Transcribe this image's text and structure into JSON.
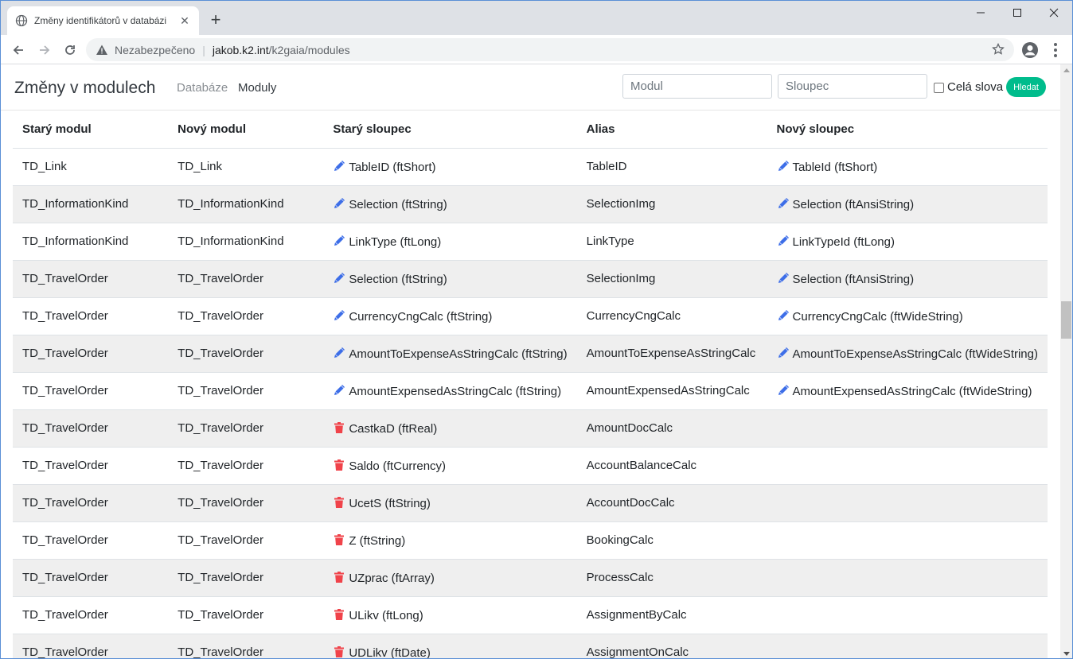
{
  "browser": {
    "tab_title": "Změny identifikátorů v databázi",
    "security_label": "Nezabezpečeno",
    "url_host": "jakob.k2.int",
    "url_path": "/k2gaia/modules"
  },
  "navbar": {
    "brand": "Změny v modulech",
    "links": [
      "Databáze",
      "Moduly"
    ],
    "modul_placeholder": "Modul",
    "sloupec_placeholder": "Sloupec",
    "whole_words_label": "Celá slova",
    "search_button": "Hledat"
  },
  "colors": {
    "accent": "#00bc8c",
    "edit_icon": "#3d6ee8",
    "delete_icon": "#f0434a"
  },
  "table": {
    "headers": [
      "Starý modul",
      "Nový modul",
      "Starý sloupec",
      "Alias",
      "Nový sloupec"
    ],
    "rows": [
      {
        "old_module": "TD_Link",
        "new_module": "TD_Link",
        "action": "edit",
        "old_column": "TableID (ftShort)",
        "alias": "TableID",
        "new_column": "TableId (ftShort)"
      },
      {
        "old_module": "TD_InformationKind",
        "new_module": "TD_InformationKind",
        "action": "edit",
        "old_column": "Selection (ftString)",
        "alias": "SelectionImg",
        "new_column": "Selection (ftAnsiString)"
      },
      {
        "old_module": "TD_InformationKind",
        "new_module": "TD_InformationKind",
        "action": "edit",
        "old_column": "LinkType (ftLong)",
        "alias": "LinkType",
        "new_column": "LinkTypeId (ftLong)"
      },
      {
        "old_module": "TD_TravelOrder",
        "new_module": "TD_TravelOrder",
        "action": "edit",
        "old_column": "Selection (ftString)",
        "alias": "SelectionImg",
        "new_column": "Selection (ftAnsiString)"
      },
      {
        "old_module": "TD_TravelOrder",
        "new_module": "TD_TravelOrder",
        "action": "edit",
        "old_column": "CurrencyCngCalc (ftString)",
        "alias": "CurrencyCngCalc",
        "new_column": "CurrencyCngCalc (ftWideString)"
      },
      {
        "old_module": "TD_TravelOrder",
        "new_module": "TD_TravelOrder",
        "action": "edit",
        "old_column": "AmountToExpenseAsStringCalc (ftString)",
        "alias": "AmountToExpenseAsStringCalc",
        "new_column": "AmountToExpenseAsStringCalc (ftWideString)"
      },
      {
        "old_module": "TD_TravelOrder",
        "new_module": "TD_TravelOrder",
        "action": "edit",
        "old_column": "AmountExpensedAsStringCalc (ftString)",
        "alias": "AmountExpensedAsStringCalc",
        "new_column": "AmountExpensedAsStringCalc (ftWideString)"
      },
      {
        "old_module": "TD_TravelOrder",
        "new_module": "TD_TravelOrder",
        "action": "delete",
        "old_column": "CastkaD (ftReal)",
        "alias": "AmountDocCalc",
        "new_column": ""
      },
      {
        "old_module": "TD_TravelOrder",
        "new_module": "TD_TravelOrder",
        "action": "delete",
        "old_column": "Saldo (ftCurrency)",
        "alias": "AccountBalanceCalc",
        "new_column": ""
      },
      {
        "old_module": "TD_TravelOrder",
        "new_module": "TD_TravelOrder",
        "action": "delete",
        "old_column": "UcetS (ftString)",
        "alias": "AccountDocCalc",
        "new_column": ""
      },
      {
        "old_module": "TD_TravelOrder",
        "new_module": "TD_TravelOrder",
        "action": "delete",
        "old_column": "Z (ftString)",
        "alias": "BookingCalc",
        "new_column": ""
      },
      {
        "old_module": "TD_TravelOrder",
        "new_module": "TD_TravelOrder",
        "action": "delete",
        "old_column": "UZprac (ftArray)",
        "alias": "ProcessCalc",
        "new_column": ""
      },
      {
        "old_module": "TD_TravelOrder",
        "new_module": "TD_TravelOrder",
        "action": "delete",
        "old_column": "ULikv (ftLong)",
        "alias": "AssignmentByCalc",
        "new_column": ""
      },
      {
        "old_module": "TD_TravelOrder",
        "new_module": "TD_TravelOrder",
        "action": "delete",
        "old_column": "UDLikv (ftDate)",
        "alias": "AssignmentOnCalc",
        "new_column": ""
      }
    ]
  }
}
